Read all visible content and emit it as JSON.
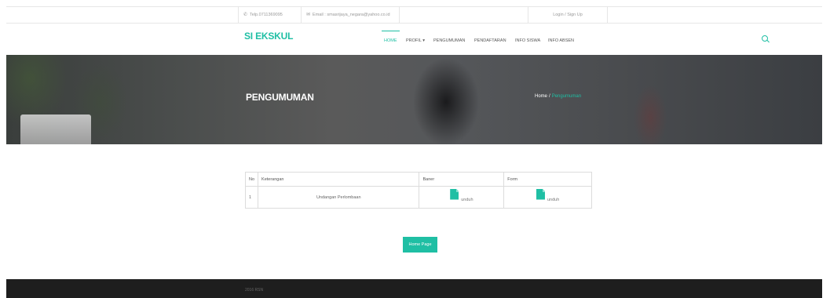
{
  "topbar": {
    "phone_icon": "phone-icon",
    "phone": "Telp.0711369095",
    "email_icon": "envelope-icon",
    "email": "Email : smasrijaya_negara@yahoo.co.id",
    "login": "Login / Sign Up"
  },
  "navbar": {
    "brand": "SI EKSKUL",
    "items": [
      {
        "label": "HOME",
        "active": true
      },
      {
        "label": "PROFIL ▾",
        "active": false
      },
      {
        "label": "PENGUMUMAN",
        "active": false
      },
      {
        "label": "PENDAFTARAN",
        "active": false
      },
      {
        "label": "INFO SISWA",
        "active": false
      },
      {
        "label": "INFO ABSEN",
        "active": false
      }
    ],
    "search_icon": "search-icon"
  },
  "hero": {
    "title": "PENGUMUMAN",
    "breadcrumb": {
      "home": "Home",
      "separator": "/",
      "current": "Pengumuman"
    }
  },
  "table": {
    "headers": [
      "No",
      "Keterangan",
      "Baner",
      "Form"
    ],
    "rows": [
      {
        "no": "1",
        "keterangan": "Undangan Perlombaan",
        "baner": "unduh",
        "form": "unduh"
      }
    ]
  },
  "button": {
    "home_page": "Home Page"
  },
  "footer": {
    "copyright": "2016 RSN"
  },
  "colors": {
    "accent": "#1fbfa4",
    "footer_bg": "#1e1e1e"
  }
}
